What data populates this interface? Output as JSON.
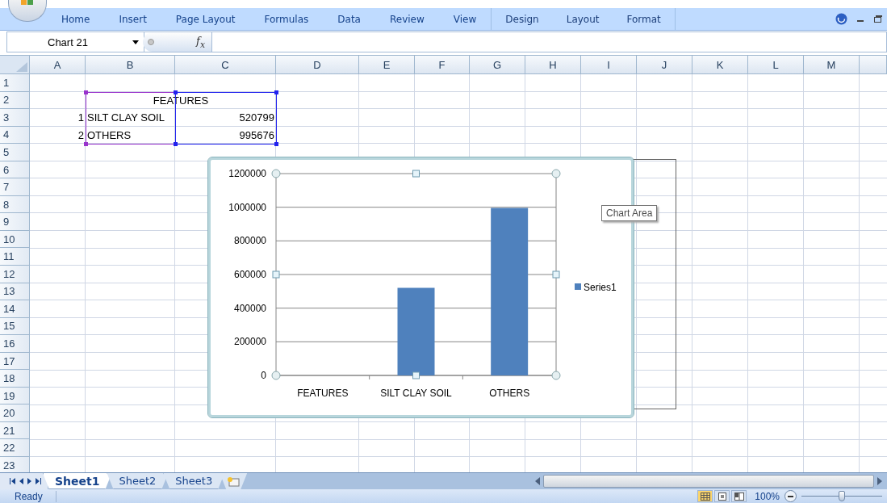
{
  "ribbon": {
    "tabs": [
      {
        "label": "Home",
        "kind": "main"
      },
      {
        "label": "Insert",
        "kind": "main"
      },
      {
        "label": "Page Layout",
        "kind": "main"
      },
      {
        "label": "Formulas",
        "kind": "main"
      },
      {
        "label": "Data",
        "kind": "main"
      },
      {
        "label": "Review",
        "kind": "main"
      },
      {
        "label": "View",
        "kind": "main"
      },
      {
        "label": "Design",
        "kind": "contextual"
      },
      {
        "label": "Layout",
        "kind": "contextual"
      },
      {
        "label": "Format",
        "kind": "contextual"
      }
    ]
  },
  "formula_bar": {
    "name_box": "Chart 21",
    "function_label": "f$_{x}$"
  },
  "sheet": {
    "columns": [
      "A",
      "B",
      "C",
      "D",
      "E",
      "F",
      "G",
      "H",
      "I",
      "J",
      "K",
      "L",
      "M"
    ],
    "rows": [
      {
        "header": "1"
      },
      {
        "header": "2",
        "B": {
          "text": "FEATURES",
          "kind": "title",
          "color": "#9933cc"
        },
        "C": {
          "kind": "covered",
          "color": "#2222ee"
        }
      },
      {
        "header": "3",
        "A": {
          "text": "1",
          "kind": "number"
        },
        "B": {
          "text": "SILT CLAY SOIL",
          "kind": "text",
          "color": "#9933cc"
        },
        "C": {
          "text": "520799",
          "kind": "number",
          "color": "#2222ee"
        }
      },
      {
        "header": "4",
        "A": {
          "text": "2",
          "kind": "number"
        },
        "B": {
          "text": "OTHERS",
          "kind": "text",
          "color": "#9933cc"
        },
        "C": {
          "text": "995676",
          "kind": "number",
          "color": "#2222ee"
        }
      },
      {
        "header": "5"
      },
      {
        "header": "6"
      },
      {
        "header": "7"
      },
      {
        "header": "8"
      },
      {
        "header": "9"
      },
      {
        "header": "10"
      },
      {
        "header": "11"
      },
      {
        "header": "12"
      },
      {
        "header": "13"
      },
      {
        "header": "14"
      },
      {
        "header": "15"
      },
      {
        "header": "16"
      },
      {
        "header": "17"
      },
      {
        "header": "18"
      },
      {
        "header": "19"
      },
      {
        "header": "20"
      },
      {
        "header": "21"
      },
      {
        "header": "22"
      },
      {
        "header": "23"
      }
    ]
  },
  "chart": {
    "tooltip": "Chart Area",
    "chart_data": {
      "type": "bar",
      "categories": [
        "FEATURES",
        "SILT CLAY SOIL",
        "OTHERS"
      ],
      "series": [
        {
          "name": "Series1",
          "color": "#4f81bd",
          "values": [
            null,
            520799,
            995676
          ]
        }
      ],
      "ylim": [
        0,
        1200000
      ],
      "grid": true,
      "yticks": [
        {
          "value": 0,
          "label": "0"
        },
        {
          "value": 200000,
          "label": "200000"
        },
        {
          "value": 400000,
          "label": "400000"
        },
        {
          "value": 600000,
          "label": "600000"
        },
        {
          "value": 800000,
          "label": "800000"
        },
        {
          "value": 1000000,
          "label": "1000000"
        },
        {
          "value": 1200000,
          "label": "1200000"
        }
      ]
    }
  },
  "sheet_tabs": [
    {
      "label": "Sheet1",
      "selected": true
    },
    {
      "label": "Sheet2",
      "selected": false
    },
    {
      "label": "Sheet3",
      "selected": false
    }
  ],
  "status_bar": {
    "status": "Ready",
    "views": [
      {
        "kind": "normal",
        "selected": true
      },
      {
        "kind": "page-layout",
        "selected": false
      },
      {
        "kind": "page-break",
        "selected": false
      }
    ],
    "zoom": "100%",
    "zoom_level": {
      "level": 0.5
    }
  }
}
